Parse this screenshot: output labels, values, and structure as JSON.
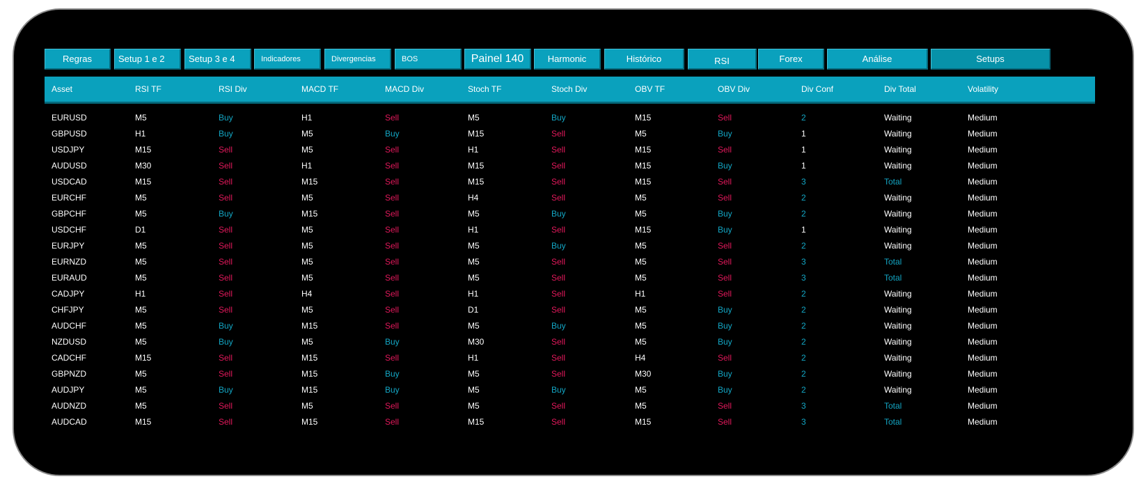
{
  "tabs": [
    {
      "label": "Regras",
      "name": "tab-regras"
    },
    {
      "label": "Setup 1 e 2",
      "name": "tab-setup-1-e-2"
    },
    {
      "label": "Setup 3 e 4",
      "name": "tab-setup-3-e-4"
    },
    {
      "label": "Indicadores",
      "name": "tab-indicadores"
    },
    {
      "label": "Divergencias",
      "name": "tab-divergencias"
    },
    {
      "label": "BOS",
      "name": "tab-bos"
    },
    {
      "label": "Painel 140",
      "name": "tab-painel-140"
    },
    {
      "label": "Harmonic",
      "name": "tab-harmonic"
    },
    {
      "label": "Histórico",
      "name": "tab-historico"
    },
    {
      "label": "RSI",
      "name": "tab-rsi"
    },
    {
      "label": "Forex",
      "name": "tab-forex"
    },
    {
      "label": "Análise",
      "name": "tab-analise"
    },
    {
      "label": "Setups",
      "name": "tab-setups"
    }
  ],
  "table": {
    "columns": [
      "Asset",
      "RSI TF",
      "RSI Div",
      "MACD TF",
      "MACD Div",
      "Stoch TF",
      "Stoch Div",
      "OBV TF",
      "OBV Div",
      "Div Conf",
      "Div Total",
      "Volatility"
    ],
    "rows": [
      [
        "EURUSD",
        "M5",
        "Buy",
        "H1",
        "Sell",
        "M5",
        "Buy",
        "M15",
        "Sell",
        "2",
        "Waiting",
        "Medium"
      ],
      [
        "GBPUSD",
        "H1",
        "Buy",
        "M5",
        "Buy",
        "M15",
        "Sell",
        "M5",
        "Buy",
        "1",
        "Waiting",
        "Medium"
      ],
      [
        "USDJPY",
        "M15",
        "Sell",
        "M5",
        "Sell",
        "H1",
        "Sell",
        "M15",
        "Sell",
        "1",
        "Waiting",
        "Medium"
      ],
      [
        "AUDUSD",
        "M30",
        "Sell",
        "H1",
        "Sell",
        "M15",
        "Sell",
        "M15",
        "Buy",
        "1",
        "Waiting",
        "Medium"
      ],
      [
        "USDCAD",
        "M15",
        "Sell",
        "M15",
        "Sell",
        "M15",
        "Sell",
        "M15",
        "Sell",
        "3",
        "Total",
        "Medium"
      ],
      [
        "EURCHF",
        "M5",
        "Sell",
        "M5",
        "Sell",
        "H4",
        "Sell",
        "M5",
        "Sell",
        "2",
        "Waiting",
        "Medium"
      ],
      [
        "GBPCHF",
        "M5",
        "Buy",
        "M15",
        "Sell",
        "M5",
        "Buy",
        "M5",
        "Buy",
        "2",
        "Waiting",
        "Medium"
      ],
      [
        "USDCHF",
        "D1",
        "Sell",
        "M5",
        "Sell",
        "H1",
        "Sell",
        "M15",
        "Buy",
        "1",
        "Waiting",
        "Medium"
      ],
      [
        "EURJPY",
        "M5",
        "Sell",
        "M5",
        "Sell",
        "M5",
        "Buy",
        "M5",
        "Sell",
        "2",
        "Waiting",
        "Medium"
      ],
      [
        "EURNZD",
        "M5",
        "Sell",
        "M5",
        "Sell",
        "M5",
        "Sell",
        "M5",
        "Sell",
        "3",
        "Total",
        "Medium"
      ],
      [
        "EURAUD",
        "M5",
        "Sell",
        "M5",
        "Sell",
        "M5",
        "Sell",
        "M5",
        "Sell",
        "3",
        "Total",
        "Medium"
      ],
      [
        "CADJPY",
        "H1",
        "Sell",
        "H4",
        "Sell",
        "H1",
        "Sell",
        "H1",
        "Sell",
        "2",
        "Waiting",
        "Medium"
      ],
      [
        "CHFJPY",
        "M5",
        "Sell",
        "M5",
        "Sell",
        "D1",
        "Sell",
        "M5",
        "Buy",
        "2",
        "Waiting",
        "Medium"
      ],
      [
        "AUDCHF",
        "M5",
        "Buy",
        "M15",
        "Sell",
        "M5",
        "Buy",
        "M5",
        "Buy",
        "2",
        "Waiting",
        "Medium"
      ],
      [
        "NZDUSD",
        "M5",
        "Buy",
        "M5",
        "Buy",
        "M30",
        "Sell",
        "M5",
        "Buy",
        "2",
        "Waiting",
        "Medium"
      ],
      [
        "CADCHF",
        "M15",
        "Sell",
        "M15",
        "Sell",
        "H1",
        "Sell",
        "H4",
        "Sell",
        "2",
        "Waiting",
        "Medium"
      ],
      [
        "GBPNZD",
        "M5",
        "Sell",
        "M15",
        "Buy",
        "M5",
        "Sell",
        "M30",
        "Buy",
        "2",
        "Waiting",
        "Medium"
      ],
      [
        "AUDJPY",
        "M5",
        "Buy",
        "M15",
        "Buy",
        "M5",
        "Buy",
        "M5",
        "Buy",
        "2",
        "Waiting",
        "Medium"
      ],
      [
        "AUDNZD",
        "M5",
        "Sell",
        "M5",
        "Sell",
        "M5",
        "Sell",
        "M5",
        "Sell",
        "3",
        "Total",
        "Medium"
      ],
      [
        "AUDCAD",
        "M15",
        "Sell",
        "M15",
        "Sell",
        "M15",
        "Sell",
        "M15",
        "Sell",
        "3",
        "Total",
        "Medium"
      ]
    ]
  },
  "colors": {
    "background": "#000000",
    "accent": "#0aa1bd",
    "buy": "#13a6c4",
    "sell": "#e2185b",
    "text": "#ffffff"
  }
}
